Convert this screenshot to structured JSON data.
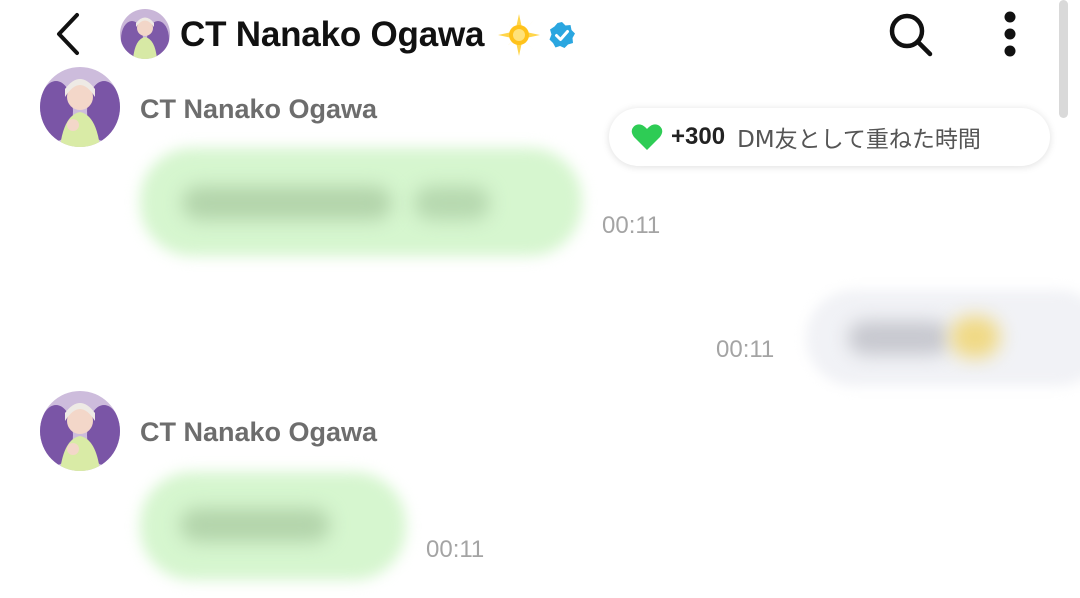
{
  "header": {
    "title": "CT Nanako Ogawa",
    "title_emoji": "star-emoji",
    "verified_icon": "verified-badge-icon",
    "icons": [
      "back-arrow-icon",
      "search-icon",
      "more-vert-icon"
    ]
  },
  "dm_badge": {
    "points": "+300",
    "label": "DM友として重ねた時間",
    "icon": "green-heart-icon",
    "heart_color": "#2ecc55"
  },
  "messages": [
    {
      "direction": "incoming",
      "sender": "CT Nanako Ogawa",
      "time": "00:11",
      "content": "blurred"
    },
    {
      "direction": "outgoing",
      "time": "00:11",
      "content": "blurred"
    },
    {
      "direction": "incoming",
      "sender": "CT Nanako Ogawa",
      "time": "00:11",
      "content": "blurred"
    }
  ],
  "colors": {
    "incoming_bubble": "#d6f6cf",
    "outgoing_bubble": "#f1f2f6",
    "verified_blue": "#2aa6e0",
    "timestamp_gray": "#a4a4a4"
  }
}
